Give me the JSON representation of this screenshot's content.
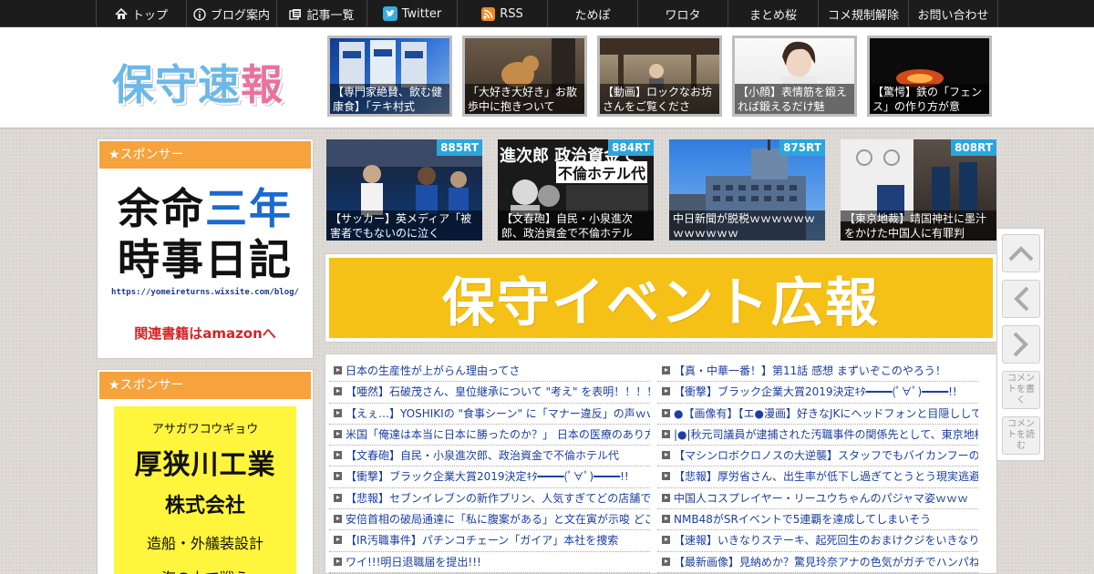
{
  "nav": [
    {
      "label": "トップ",
      "icon": "home-icon"
    },
    {
      "label": "ブログ案内",
      "icon": "info-icon"
    },
    {
      "label": "記事一覧",
      "icon": "list-icon"
    },
    {
      "label": "Twitter",
      "icon": "twitter-icon"
    },
    {
      "label": "RSS",
      "icon": "rss-icon"
    },
    {
      "label": "ためぽ",
      "icon": ""
    },
    {
      "label": "ワロタ",
      "icon": ""
    },
    {
      "label": "まとめ桜",
      "icon": ""
    },
    {
      "label": "コメ規制解除",
      "icon": ""
    },
    {
      "label": "お問い合わせ",
      "icon": ""
    }
  ],
  "header": {
    "logo_main": "保守速",
    "logo_pink": "報",
    "thumbs": [
      "【専門家絶賛、飲む健康食】「テキ村式",
      "「大好き大好き」お散歩中に抱きついて",
      "【動画】ロックなお坊さんをご覧くださ",
      "【小顔】表情筋を鍛えれば鍛えるだけ魅",
      "【驚愕】鉄の「フェンス」の作り方が意"
    ]
  },
  "sidebar": {
    "sponsor_title_1": "★スポンサー",
    "ad1_line1a": "余命",
    "ad1_line1b": "三年",
    "ad1_line2": "時事日記",
    "ad1_url": "https://yomeireturns.wixsite.com/blog/",
    "ad1_link": "関連書籍はamazonへ",
    "sponsor_title_2": "★スポンサー",
    "ad2_kana": "アサガワコウギョウ",
    "ad2_name": "厚狭川工業",
    "ad2_corp": "株式会社",
    "ad2_biz": "造船・外艤装設計",
    "ad2_more": "海の上で戦う"
  },
  "ranking": [
    {
      "rt": "885RT",
      "caption": "【サッカー】英メディア「被害者でもないのに泣く"
    },
    {
      "rt": "884RT",
      "caption": "【文春砲】自民・小泉進次郎、政治資金で不倫ホテル"
    },
    {
      "rt": "875RT",
      "caption": "中日新聞が脱税ｗｗｗｗｗｗｗｗｗｗｗｗ"
    },
    {
      "rt": "808RT",
      "caption": "【東京地裁】靖国神社に墨汁をかけた中国人に有罪判"
    }
  ],
  "rank_overlay": {
    "top": "進次郎 政治資金で",
    "mid": "不倫ホテル代"
  },
  "banner_text": "保守イベント広報",
  "list_left": [
    "日本の生産性が上がらん理由ってさ",
    "【唖然】石破茂さん、皇位継承について \"考え\" を表明！！！！",
    "【えぇ…】YOSHIKIの \"食事シーン\" に「マナー違反」の声ｗｗ",
    "米国「俺達は本当に日本に勝ったのか？」 日本の医療のあり方",
    "【文春砲】自民・小泉進次郎、政治資金で不倫ホテル代",
    "【衝撃】ブラック企業大賞2019決定ｷﾀ━━━━(ﾟ∀ﾟ)━━━━!!",
    "【悲報】セブンイレブンの新作プリン、人気すぎてどの店舗で",
    "安倍首相の破局通達に「私に腹案がある」と文在寅が示唆 どこ",
    "【IR汚職事件】パチンコチェーン「ガイア」本社を捜索",
    "ワイ!!!明日退職届を提出!!!"
  ],
  "list_right": [
    "【真・中華一番！】第11話 感想 まずいぞこのやろう！",
    "【衝撃】ブラック企業大賞2019決定ｷﾀ━━━━(ﾟ∀ﾟ)━━━━!!",
    "●【画像有】【エ●漫画】好きなJKにヘッドフォンと目隠しして",
    "|●|秋元司議員が逮捕された汚職事件の関係先として、東京地検",
    "【マシンロボクロノスの大逆襲】スタッフでもバイカンフーの",
    "【悲報】厚労省さん、出生率が低下し過ぎてとうとう現実逃避",
    "中国人コスプレイヤー・リーユウちゃんのパジャマ姿ｗｗｗ",
    "NMB48がSRイベントで5連覇を達成してしまいそう",
    "【速報】いきなりステーキ、起死回生のおまけクジをいきなり",
    "【最新画像】見納めか？驚見玲奈アナの色気がガチでハンパね"
  ],
  "side_buttons": {
    "comment_write": "コメントを書く",
    "comment_read": "コメントを読む"
  }
}
